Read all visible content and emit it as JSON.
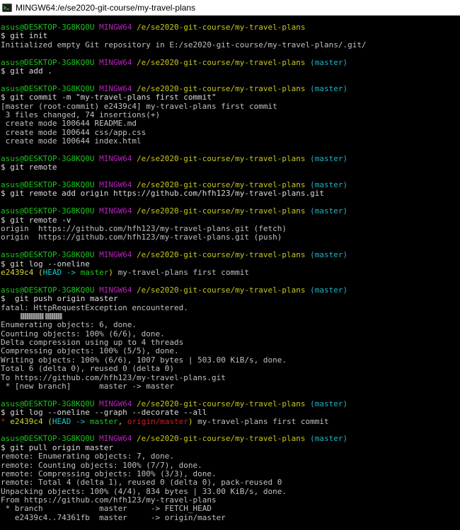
{
  "window": {
    "title": "MINGW64:/e/se2020-git-course/my-travel-plans",
    "icon": "mingw-terminal-icon"
  },
  "colors": {
    "user": "#1cc51c",
    "msystem": "#b624b6",
    "path": "#c8c81e",
    "branch": "#1eb4c8"
  },
  "terminal": {
    "prompt": {
      "user": "asus@DESKTOP-3G8KQ0U",
      "msystem": "MINGW64",
      "path": "/e/se2020-git-course/my-travel-plans",
      "branch": "(master)"
    },
    "l1_cmd": "$ git init",
    "l2_out": "Initialized empty Git repository in E:/se2020-git-course/my-travel-plans/.git/",
    "l4_cmd": "$ git add .",
    "l6_cmd": "$ git commit -m \"my-travel-plans first commit\"",
    "l7_out": "[master (root-commit) e2439c4] my-travel-plans first commit",
    "l8_out": " 3 files changed, 74 insertions(+)",
    "l9_out": " create mode 100644 README.md",
    "l10_out": " create mode 100644 css/app.css",
    "l11_out": " create mode 100644 index.html",
    "l13_cmd": "$ git remote",
    "l15_cmd": "$ git remote add origin https://github.com/hfh123/my-travel-plans.git",
    "l17_cmd": "$ git remote -v",
    "l18_out": "origin  https://github.com/hfh123/my-travel-plans.git (fetch)",
    "l19_out": "origin  https://github.com/hfh123/my-travel-plans.git (push)",
    "l21_cmd": "$ git log --oneline",
    "l22_hash": "e2439c4",
    "l22_ref_open": "(",
    "l22_head": "HEAD -> ",
    "l22_master": "master",
    "l22_ref_close": ")",
    "l22_msg": " my-travel-plans first commit",
    "l24_cmd": "$  git push origin master",
    "l25_out": "fatal: HttpRequestException encountered.",
    "l27_out": "Enumerating objects: 6, done.",
    "l28_out": "Counting objects: 100% (6/6), done.",
    "l29_out": "Delta compression using up to 4 threads",
    "l30_out": "Compressing objects: 100% (5/5), done.",
    "l31_out": "Writing objects: 100% (6/6), 1007 bytes | 503.00 KiB/s, done.",
    "l32_out": "Total 6 (delta 0), reused 0 (delta 0)",
    "l33_out": "To https://github.com/hfh123/my-travel-plans.git",
    "l34_out": " * [new branch]      master -> master",
    "l36_cmd": "$ git log --oneline --graph --decorate --all",
    "l37_star": "* ",
    "l37_hash": "e2439c4",
    "l37_ref_open": " (",
    "l37_head": "HEAD -> ",
    "l37_master": "master",
    "l37_comma": ", ",
    "l37_origin": "origin/master",
    "l37_ref_close": ")",
    "l37_msg": " my-travel-plans first commit",
    "l39_cmd": "$ git pull origin master",
    "l40_out": "remote: Enumerating objects: 7, done.",
    "l41_out": "remote: Counting objects: 100% (7/7), done.",
    "l42_out": "remote: Compressing objects: 100% (3/3), done.",
    "l43_out": "remote: Total 4 (delta 1), reused 0 (delta 0), pack-reused 0",
    "l44_out": "Unpacking objects: 100% (4/4), 834 bytes | 33.00 KiB/s, done.",
    "l45_out": "From https://github.com/hfh123/my-travel-plans",
    "l46_out": " * branch            master     -> FETCH_HEAD",
    "l47_out": "   e2439c4..74361fb  master     -> origin/master"
  }
}
